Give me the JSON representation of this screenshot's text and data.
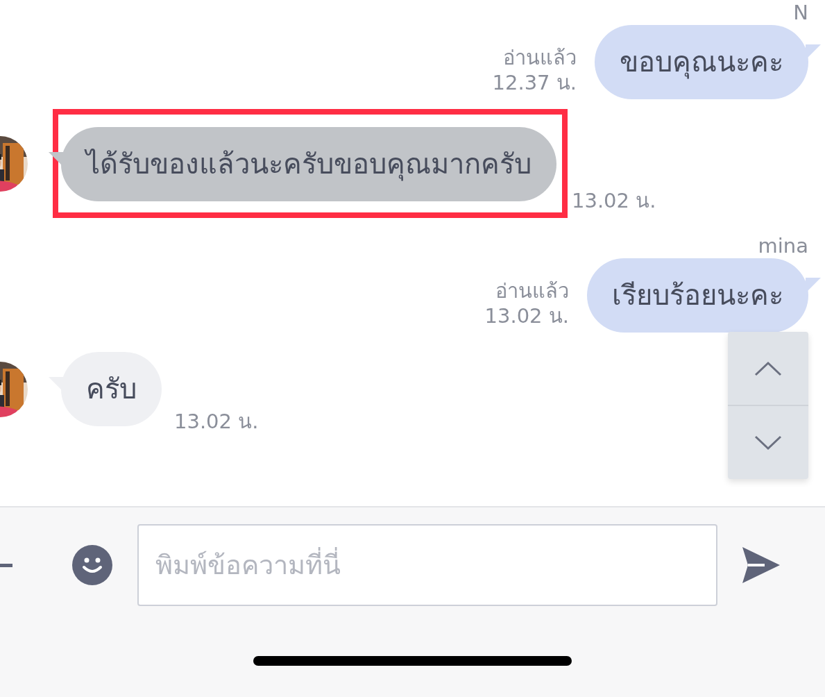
{
  "messages": [
    {
      "kind": "outgoing",
      "sender": "N",
      "text": "ขอบคุณนะคะ",
      "read": "อ่านแล้ว",
      "time": "12.37 น."
    },
    {
      "kind": "incoming",
      "text": "ได้รับของแล้วนะครับขอบคุณมากครับ",
      "time": "13.02 น.",
      "highlighted": true
    },
    {
      "kind": "outgoing",
      "sender": "mina",
      "text": "เรียบร้อยนะคะ",
      "read": "อ่านแล้ว",
      "time": "13.02 น."
    },
    {
      "kind": "incoming",
      "text": "ครับ",
      "time": "13.02 น.",
      "highlighted": false
    }
  ],
  "composer": {
    "placeholder": "พิมพ์ข้อความที่นี่"
  }
}
